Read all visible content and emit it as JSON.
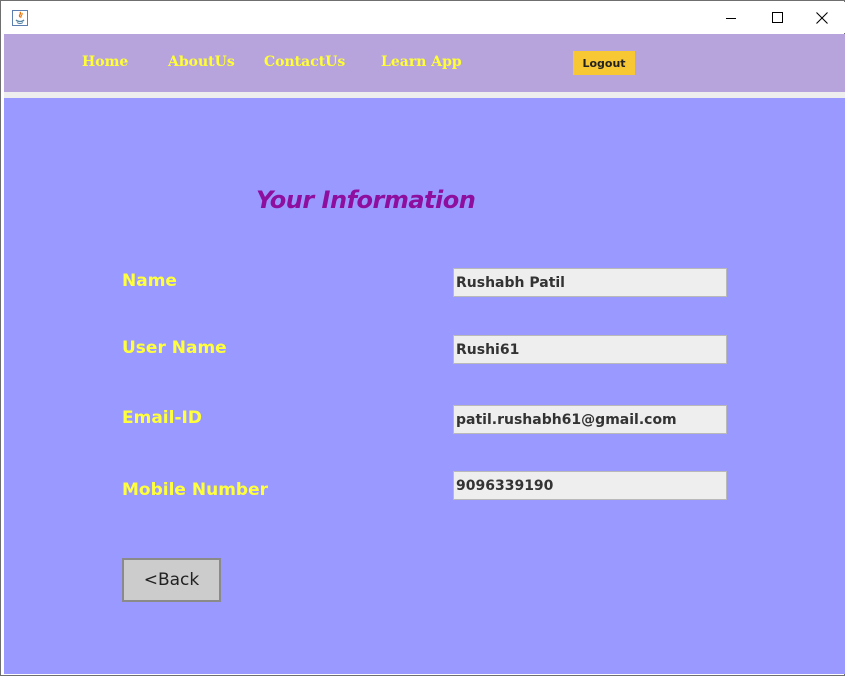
{
  "window": {
    "title": "",
    "controls": {
      "minimize_icon": "minimize-icon",
      "maximize_icon": "maximize-icon",
      "close_icon": "close-icon"
    }
  },
  "navbar": {
    "links": [
      "Home",
      "AboutUs",
      "ContactUs",
      "Learn App"
    ],
    "logout_label": "Logout"
  },
  "content": {
    "title": "Your Information",
    "fields": [
      {
        "label": "Name",
        "value": "Rushabh Patil"
      },
      {
        "label": "User Name",
        "value": "Rushi61"
      },
      {
        "label": "Email-ID",
        "value": "patil.rushabh61@gmail.com"
      },
      {
        "label": "Mobile Number",
        "value": "9096339190"
      }
    ],
    "back_label": "<Back"
  },
  "colors": {
    "navbar_bg": "#b8a4dd",
    "content_bg": "#9999ff",
    "nav_text": "#ffff33",
    "label_text": "#ffff3c",
    "title_text": "#8e0ea0",
    "logout_bg": "#f7c734"
  }
}
